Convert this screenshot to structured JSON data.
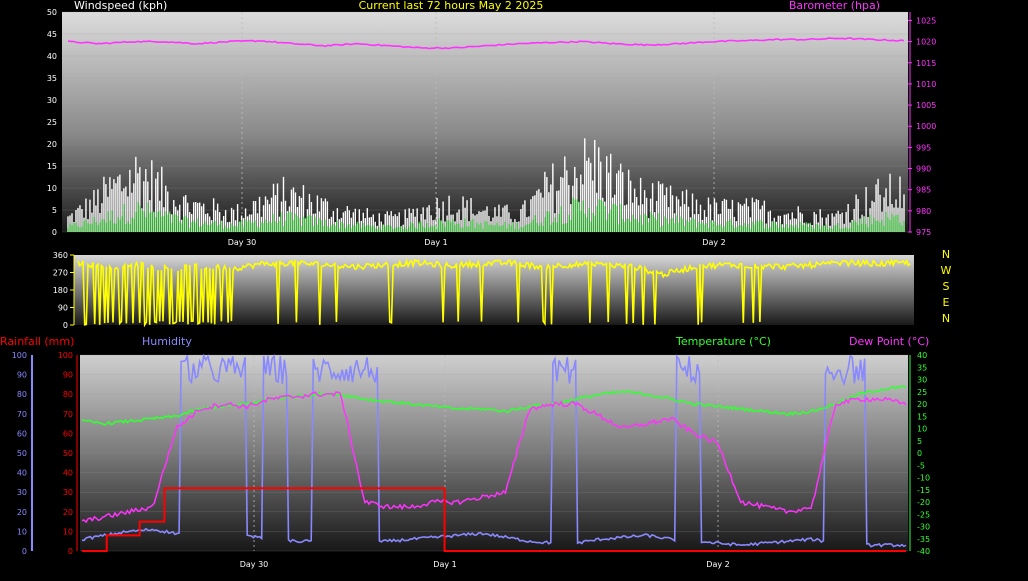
{
  "header": {
    "title": "Current last 72 hours May 2 2025",
    "left_label": "Windspeed (kph)",
    "right_label": "Barometer (hpa)"
  },
  "compass": [
    "N",
    "W",
    "S",
    "E",
    "N"
  ],
  "bottom_header": {
    "rainfall": "Rainfall (mm)",
    "humidity": "Humidity",
    "temperature": "Temperature (°C)",
    "dewpoint": "Dew Point (°C)"
  },
  "colors": {
    "wind": "#ffffff",
    "wind_avg": "#66ff66",
    "barometer": "#ff33ff",
    "direction": "#ffff00",
    "rain": "#ff0000",
    "humidity": "#8888ff",
    "temperature": "#33ff33",
    "dewpoint": "#ff33ff",
    "title": "#ffff00"
  },
  "chart_data": [
    {
      "type": "line",
      "name": "wind-barometer",
      "days": [
        "Day 30",
        "Day 1",
        "Day 2"
      ],
      "y_left": {
        "ticks": [
          0,
          5,
          10,
          15,
          20,
          25,
          30,
          35,
          40,
          45,
          50
        ],
        "range": [
          0,
          50
        ]
      },
      "y_right": {
        "ticks": [
          975,
          980,
          985,
          990,
          995,
          1000,
          1005,
          1010,
          1015,
          1020,
          1025
        ],
        "range": [
          975,
          1027
        ]
      },
      "series": [
        {
          "name": "Windspeed (kph)",
          "values": [
            3,
            6,
            10,
            13,
            9,
            6,
            5,
            4,
            6,
            8,
            7,
            5,
            4,
            3,
            3,
            5,
            6,
            5,
            4,
            4,
            9,
            13,
            15,
            11,
            8,
            7,
            6,
            5,
            5,
            5,
            4,
            4,
            3,
            6,
            8,
            9
          ]
        },
        {
          "name": "Barometer (hpa)",
          "values": [
            1020,
            1019.5,
            1020,
            1020,
            1019.5,
            1020,
            1020.2,
            1019.5,
            1019,
            1019.5,
            1019,
            1018.5,
            1018.5,
            1019,
            1019.5,
            1019.8,
            1020,
            1019.5,
            1019.2,
            1019.5,
            1020,
            1020.2,
            1020.5,
            1020.5,
            1020.8,
            1020.5,
            1020.2
          ]
        }
      ]
    },
    {
      "type": "line",
      "name": "wind-direction",
      "y_ticks": [
        0,
        90,
        180,
        270,
        360
      ],
      "range": [
        0,
        360
      ],
      "series": [
        {
          "name": "Wind direction",
          "values": [
            320,
            300,
            310,
            290,
            300,
            290,
            315,
            320,
            310,
            300,
            310,
            320,
            305,
            315,
            320,
            300,
            310,
            310,
            300,
            260,
            300,
            310,
            305,
            300,
            310,
            320,
            315,
            320
          ]
        }
      ]
    },
    {
      "type": "line",
      "name": "rain-humidity-temp-dew",
      "y_left": {
        "ticks": [
          0,
          10,
          20,
          30,
          40,
          50,
          60,
          70,
          80,
          90,
          100
        ],
        "range": [
          0,
          100
        ]
      },
      "y_right": {
        "ticks": [
          40,
          35,
          30,
          25,
          20,
          15,
          10,
          5,
          0,
          -5,
          -10,
          -15,
          -20,
          -25,
          -30,
          -35,
          -40
        ],
        "range": [
          -40,
          40
        ]
      },
      "series": [
        {
          "name": "Rainfall (mm)",
          "x": [
            0,
            0.02,
            0.03,
            0.06,
            0.07,
            0.1,
            0.44,
            0.44,
            1
          ],
          "values": [
            0,
            0,
            8,
            8,
            15,
            32,
            32,
            0,
            0
          ]
        },
        {
          "name": "Humidity",
          "values": [
            6,
            8,
            10,
            11,
            9,
            8,
            7,
            8,
            6,
            5,
            5,
            4,
            4,
            5,
            6,
            7,
            8,
            9,
            7,
            5,
            4,
            4,
            6,
            7,
            8,
            6,
            5,
            4,
            3,
            4,
            5,
            6,
            4,
            3,
            3,
            3
          ]
        },
        {
          "name": "Temperature (°C)",
          "values": [
            13,
            12,
            13,
            14,
            15,
            18,
            19,
            20,
            22,
            23,
            24,
            24,
            22,
            21,
            20,
            19,
            18,
            18,
            17,
            19,
            20,
            22,
            24,
            25,
            24,
            22,
            20,
            19,
            18,
            17,
            16,
            17,
            20,
            24,
            26,
            27
          ]
        },
        {
          "name": "Dew Point (°C)",
          "values": [
            -28,
            -26,
            -24,
            -22,
            10,
            18,
            20,
            19,
            22,
            23,
            24,
            24,
            -20,
            -22,
            -22,
            -20,
            -20,
            -18,
            -16,
            18,
            20,
            20,
            15,
            10,
            12,
            14,
            8,
            4,
            -20,
            -22,
            -24,
            -22,
            20,
            22,
            22,
            20
          ]
        }
      ]
    }
  ]
}
